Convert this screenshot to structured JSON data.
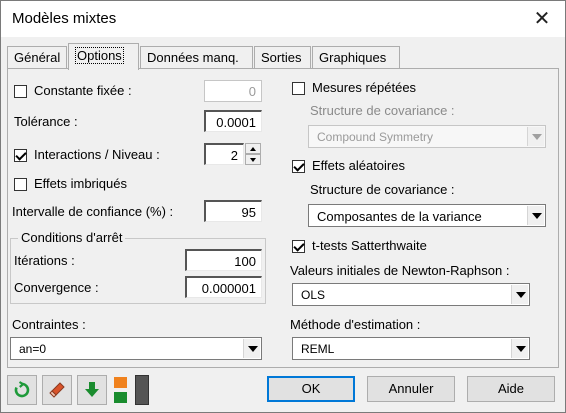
{
  "window": {
    "title": "Modèles mixtes"
  },
  "tabs": [
    {
      "label": "Général"
    },
    {
      "label": "Options"
    },
    {
      "label": "Données manq."
    },
    {
      "label": "Sorties"
    },
    {
      "label": "Graphiques"
    }
  ],
  "options": {
    "constante_fixee": {
      "label": "Constante fixée :",
      "checked": false,
      "value": "0"
    },
    "tolerance": {
      "label": "Tolérance :",
      "value": "0.0001"
    },
    "interactions": {
      "label": "Interactions / Niveau :",
      "checked": true,
      "value": "2"
    },
    "effets_imbriques": {
      "label": "Effets imbriqués",
      "checked": false
    },
    "intervalle": {
      "label": "Intervalle de confiance (%) :",
      "value": "95"
    },
    "conditions_arret": {
      "title": "Conditions d'arrêt",
      "iterations": {
        "label": "Itérations :",
        "value": "100"
      },
      "convergence": {
        "label": "Convergence :",
        "value": "0.000001"
      }
    },
    "contraintes": {
      "label": "Contraintes :",
      "value": "an=0"
    },
    "mesures_repetees": {
      "label": "Mesures répétées",
      "checked": false,
      "structure_label": "Structure de covariance :",
      "structure_value": "Compound Symmetry"
    },
    "effets_aleatoires": {
      "label": "Effets aléatoires",
      "checked": true,
      "structure_label": "Structure de covariance :",
      "structure_value": "Composantes de la variance"
    },
    "satterthwaite": {
      "label": "t-tests Satterthwaite",
      "checked": true
    },
    "newton_raphson": {
      "label": "Valeurs initiales de Newton-Raphson :",
      "value": "OLS"
    },
    "methode": {
      "label": "Méthode d'estimation :",
      "value": "REML"
    }
  },
  "footer": {
    "icons": [
      "reset-icon",
      "eraser-icon",
      "download-arrow-icon",
      "color-split-icon"
    ],
    "ok_label": "OK",
    "cancel_label": "Annuler",
    "help_label": "Aide"
  },
  "colors": {
    "reset_green": "#1e9a3a",
    "arrow_green": "#1a8c2e",
    "eraser_red": "#d9532a",
    "orange": "#f0821e",
    "default_blue": "#0078d7"
  }
}
